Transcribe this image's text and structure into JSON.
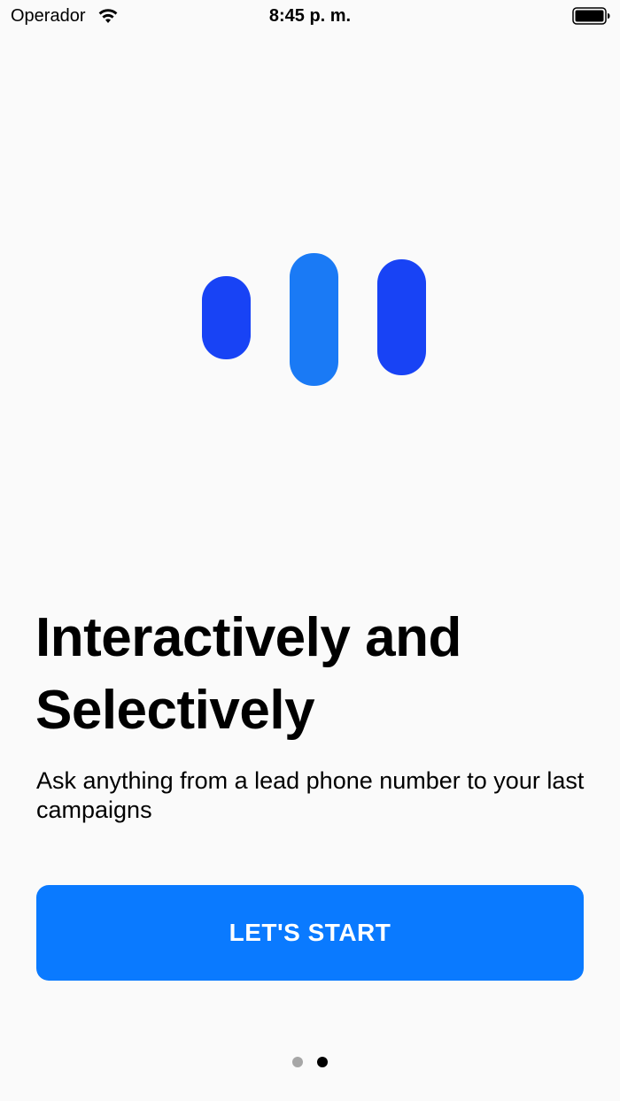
{
  "status_bar": {
    "carrier": "Operador",
    "time": "8:45 p. m.",
    "wifi_icon": "wifi-icon",
    "battery_icon": "battery-full-icon"
  },
  "logo": {
    "icon": "audio-bars-logo",
    "colors": {
      "left_bar": "#1843f5",
      "middle_bar": "#1a7af5",
      "right_bar": "#1843f5"
    }
  },
  "onboarding": {
    "title": "Interactively and Selectively",
    "subtitle": "Ask anything from a lead phone number to your last campaigns",
    "cta_label": "LET'S START",
    "cta_color": "#0a7aff"
  },
  "pagination": {
    "page_count": 2,
    "current_page": 2,
    "active_color": "#000000",
    "inactive_color": "#a6a6a6"
  }
}
